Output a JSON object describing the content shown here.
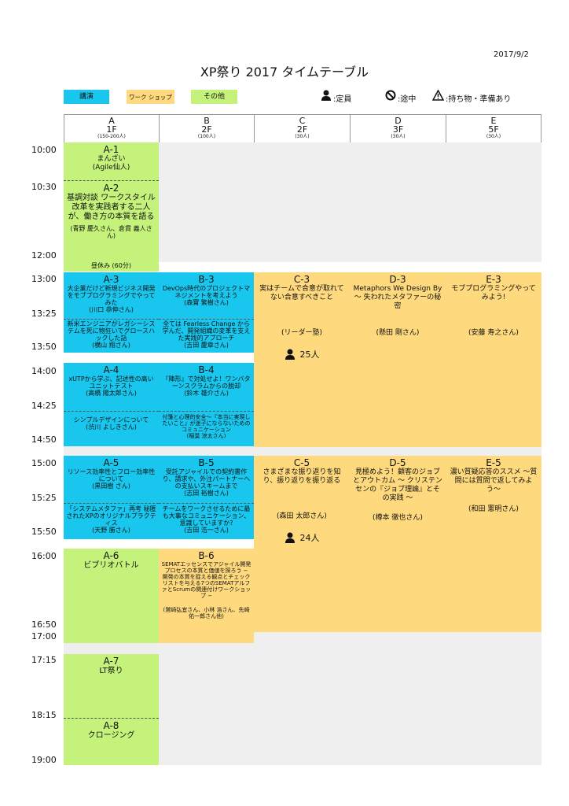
{
  "header": {
    "date": "2017/9/2",
    "title": "XP祭り 2017 タイムテーブル",
    "legend": {
      "talk": "講演",
      "workshop": "ワーク ショップ",
      "other": "その他",
      "capacity": ":定員",
      "no_midway": ":途中",
      "bring": ":持ち物・準備あり"
    }
  },
  "columns": [
    {
      "id": "A",
      "floor": "1F",
      "cap": "(150-200人)"
    },
    {
      "id": "B",
      "floor": "2F",
      "cap": "(100人)"
    },
    {
      "id": "C",
      "floor": "2F",
      "cap": "(30人)"
    },
    {
      "id": "D",
      "floor": "3F",
      "cap": "(30人)"
    },
    {
      "id": "E",
      "floor": "5F",
      "cap": "(30人)"
    }
  ],
  "times": [
    "10:00",
    "10:30",
    "12:00",
    "13:00",
    "13:25",
    "13:50",
    "14:00",
    "14:25",
    "14:50",
    "15:00",
    "15:25",
    "15:50",
    "16:00",
    "16:50",
    "17:00",
    "17:15",
    "18:15",
    "19:00"
  ],
  "sessions": {
    "a1": {
      "id": "A-1",
      "title": "まんざい",
      "speaker": "(Agile仙人)"
    },
    "a2": {
      "id": "A-2",
      "title": "基調対談 ワークスタイル改革を実践者する二人が、働き方の本質を語る",
      "speaker": "(青野 慶久さん、倉貫 義人さん)"
    },
    "lunch": "昼休み (60分)",
    "a3a": {
      "id": "A-3",
      "title": "大企業だけど新規ビジネス開発をモブプログラミングでやってみた",
      "speaker": "(川口 恭伸さん)"
    },
    "a3b": {
      "title": "新米エンジニアがレガシーシステムを死に物狂いでグロースハックした話",
      "speaker": "(横山 翔さん)"
    },
    "b3a": {
      "id": "B-3",
      "title": "DevOps時代のプロジェクトマネジメントを考えよう",
      "speaker": "(森實 繁樹さん)"
    },
    "b3b": {
      "title": "全ては Fearless Change から学んだ、開発組織の変革を支えた実践的アプローチ",
      "speaker": "(吉田 慶章さん)"
    },
    "c3": {
      "id": "C-3",
      "title": "実はチームで合意が取れてない合意すべきこと",
      "speaker": "(リーダー塾)",
      "count": "25人"
    },
    "d3": {
      "id": "D-3",
      "title": "Metaphors We Design By 〜 失われたメタファーの秘密",
      "speaker": "(懸田 剛さん)"
    },
    "e3": {
      "id": "E-3",
      "title": "モブプログラミングやってみよう!",
      "speaker": "(安藤 寿之さん)"
    },
    "a4a": {
      "id": "A-4",
      "title": "xUTPから学ぶ、記述性の高いユニットテスト",
      "speaker": "(高橋 陽太郎さん)"
    },
    "a4b": {
      "title": "シンプルデザインについて",
      "speaker": "(渋川 よしきさん)"
    },
    "b4a": {
      "id": "B-4",
      "title": "『陣形』で対処せよ！ワンバターンスクラムからの脱却",
      "speaker": "(鈴木 雄介さん)"
    },
    "b4b": {
      "title": "付箋と心理的安全〜『本当に実現したいこと』が迷子にならないためのコミュニケーション",
      "speaker": "(稲葉 涼太さん)"
    },
    "a5a": {
      "id": "A-5",
      "title": "リソース効率性とフロー効率性について",
      "speaker": "(黒田樹 さん)"
    },
    "a5b": {
      "title": "「システムメタファ」再考 秘匿されたXPのオリジナルプラクティス",
      "speaker": "(天野 勝さん)"
    },
    "b5a": {
      "id": "B-5",
      "title": "受託アジャイルでの契約書作り、請求や、外注パートナーへの支払いスキームまで",
      "speaker": "(志田 裕樹さん)"
    },
    "b5b": {
      "title": "チームをワークさせるために最も大事なコミュニケーション、意識していますか?",
      "speaker": "(吉田 浩一さん)"
    },
    "c5": {
      "id": "C-5",
      "title": "さまざまな振り返りを知り、振り返りを振り返る",
      "speaker": "(森田 太郎さん)",
      "count": "24人"
    },
    "d5": {
      "id": "D-5",
      "title": "見極めよう！顧客のジョブとアウトカム 〜 クリステンセンの『ジョブ理論』とその実践 〜",
      "speaker": "(樽本 徹也さん)"
    },
    "e5": {
      "id": "E-5",
      "title": "濃い質疑応答のススメ 〜質問には質問で返してみよう〜",
      "speaker": "(和田 憲明さん)"
    },
    "a6": {
      "id": "A-6",
      "title": "ビブリオバトル"
    },
    "b6": {
      "id": "B-6",
      "title": "SEMATエッセンスでアジャイル開発プロセスの本質と価値を探ろう − 開発の本質を捉える観点とチェックリストを与える7つのSEMATアルファとScrumの関連付けワークショップ −",
      "speaker": "(鷲崎弘宜さん、小林 浩さん、先崎佑一郎さん他)"
    },
    "a7": {
      "id": "A-7",
      "title": "LT祭り"
    },
    "a8": {
      "id": "A-8",
      "title": "クロージング"
    }
  }
}
